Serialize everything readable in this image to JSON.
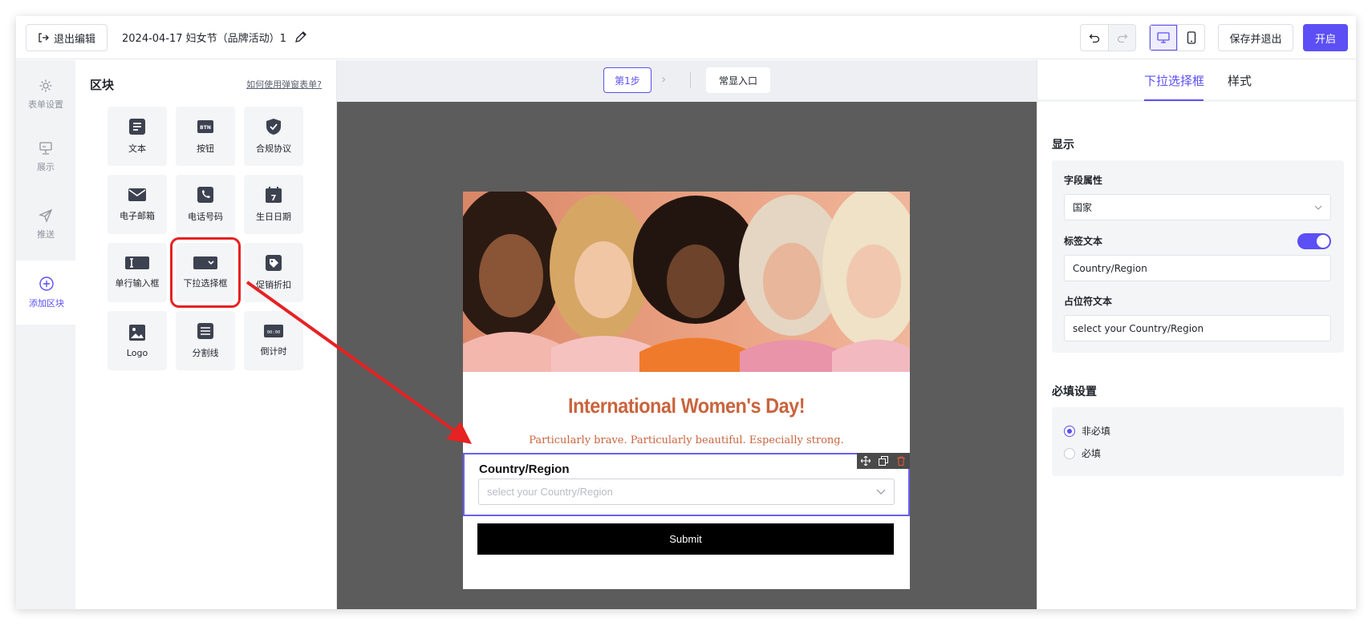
{
  "header": {
    "exit_label": "退出编辑",
    "doc_title": "2024-04-17 妇女节（品牌活动）1",
    "save_exit_label": "保存并退出",
    "open_label": "开启"
  },
  "rail": {
    "items": [
      {
        "label": "表单设置",
        "icon": "gear-icon"
      },
      {
        "label": "展示",
        "icon": "display-icon"
      },
      {
        "label": "推送",
        "icon": "send-icon"
      },
      {
        "label": "添加区块",
        "icon": "plus-circle-icon"
      }
    ]
  },
  "blocks": {
    "title": "区块",
    "help_link": "如何使用弹窗表单?",
    "items": [
      {
        "label": "文本",
        "icon": "text-icon"
      },
      {
        "label": "按钮",
        "icon": "button-icon",
        "badge": "BTN"
      },
      {
        "label": "合规协议",
        "icon": "shield-check-icon"
      },
      {
        "label": "电子邮箱",
        "icon": "mail-icon"
      },
      {
        "label": "电话号码",
        "icon": "phone-icon"
      },
      {
        "label": "生日日期",
        "icon": "calendar-icon",
        "badge": "7"
      },
      {
        "label": "单行输入框",
        "icon": "text-input-icon"
      },
      {
        "label": "下拉选择框",
        "icon": "dropdown-icon"
      },
      {
        "label": "促销折扣",
        "icon": "tag-icon"
      },
      {
        "label": "Logo",
        "icon": "image-icon"
      },
      {
        "label": "分割线",
        "icon": "divider-icon"
      },
      {
        "label": "倒计时",
        "icon": "countdown-icon",
        "badge": "00:00"
      }
    ]
  },
  "canvas": {
    "step_label": "第1步",
    "entry_label": "常显入口",
    "popup": {
      "headline": "International Women's Day!",
      "subline": "Particularly brave. Particularly beautiful. Especially strong.",
      "field_label": "Country/Region",
      "field_placeholder": "select your Country/Region",
      "submit_label": "Submit"
    }
  },
  "right_panel": {
    "tabs": [
      "下拉选择框",
      "样式"
    ],
    "display_title": "显示",
    "field_attr_label": "字段属性",
    "field_attr_value": "国家",
    "label_text_label": "标签文本",
    "label_text_value": "Country/Region",
    "placeholder_label": "占位符文本",
    "placeholder_value": "select your Country/Region",
    "required_title": "必填设置",
    "radio_optional": "非必填",
    "radio_required": "必填"
  },
  "colors": {
    "accent": "#5b4ff5",
    "headline": "#c9643e",
    "highlight": "#e62222"
  }
}
